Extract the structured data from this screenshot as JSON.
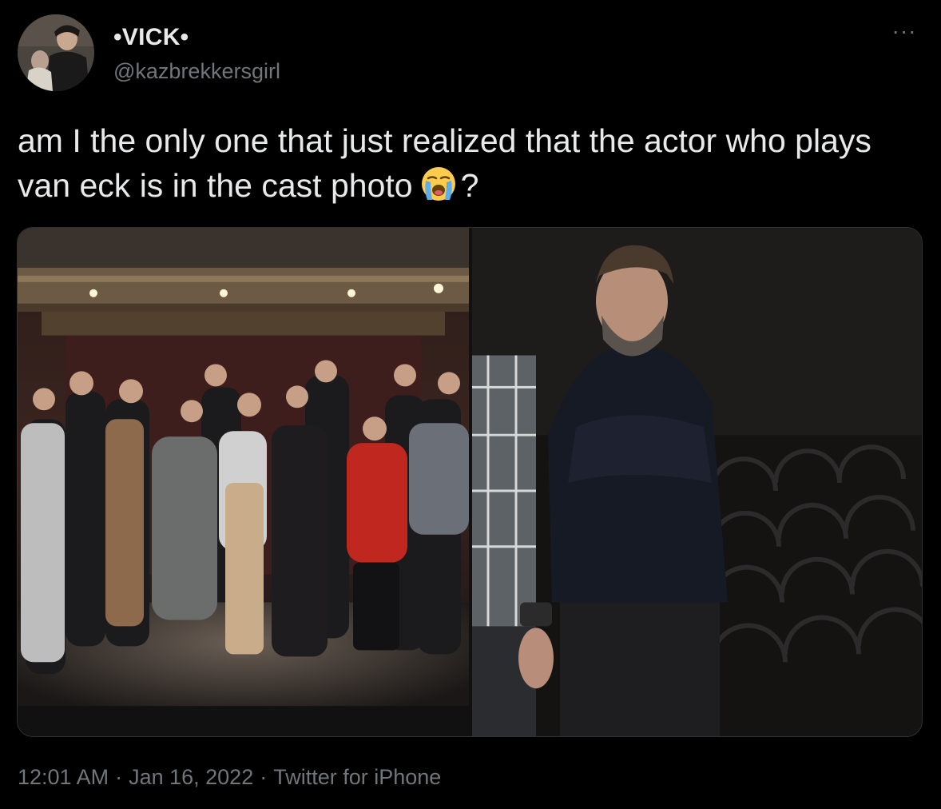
{
  "user": {
    "display_name": "•VICK•",
    "handle": "@kazbrekkersgirl",
    "avatar_icon": "profile-photo"
  },
  "more_icon": "more-dots-icon",
  "tweet": {
    "text_before_emoji": "am I the only one that just realized that the actor who plays van eck is in the cast photo",
    "emoji": "loudly-crying-face-emoji",
    "text_after_emoji": "?"
  },
  "media": {
    "images": [
      {
        "subject": "cast-photo-on-theatre-stage"
      },
      {
        "subject": "cropped-actor-in-black-sweater"
      }
    ]
  },
  "footer": {
    "time": "12:01 AM",
    "date": "Jan 16, 2022",
    "source": "Twitter for iPhone",
    "separator": "·"
  },
  "colors": {
    "background": "#000000",
    "primary_text": "#e7e9ea",
    "secondary_text": "#71767b"
  }
}
